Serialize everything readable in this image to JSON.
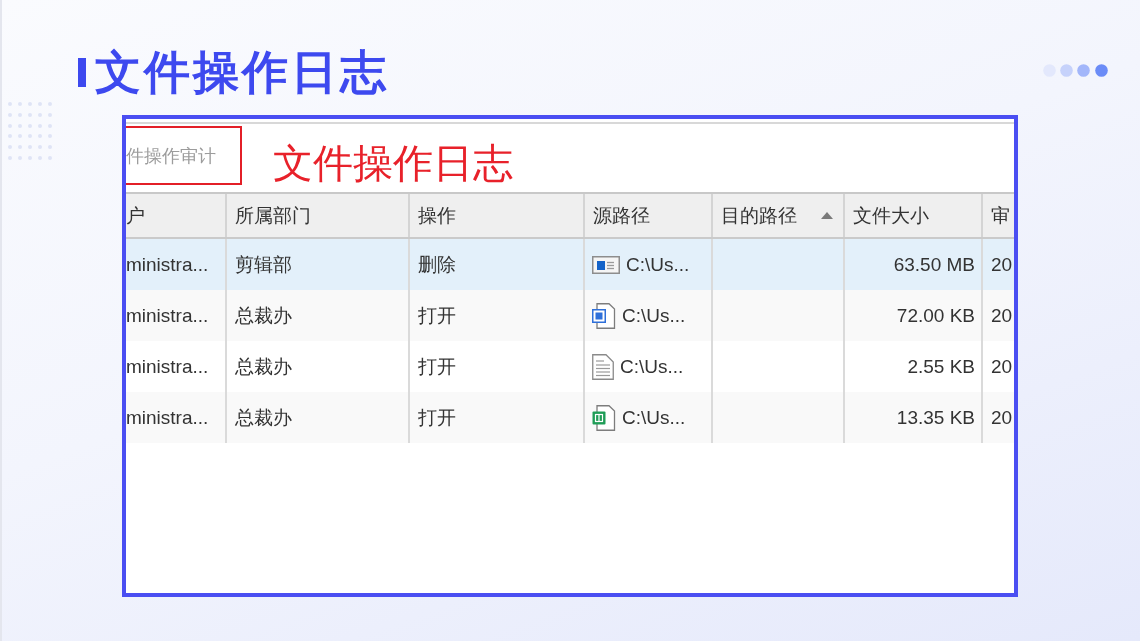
{
  "title": "文件操作日志",
  "screenshot": {
    "nav_tab": {
      "label": "件操作审计"
    },
    "annotation": "文件操作日志",
    "table": {
      "columns": [
        {
          "label": "户",
          "sorted": false
        },
        {
          "label": "所属部门",
          "sorted": false
        },
        {
          "label": "操作",
          "sorted": false
        },
        {
          "label": "源路径",
          "sorted": false
        },
        {
          "label": "目的路径",
          "sorted": true
        },
        {
          "label": "文件大小",
          "sorted": false
        },
        {
          "label": "审",
          "sorted": false
        }
      ],
      "rows": [
        {
          "selected": true,
          "kind": "media",
          "column_1": "ministra...",
          "department": "剪辑部",
          "action": "删除",
          "source_path": "C:\\Us...",
          "file_size": "63.50 MB",
          "column_7": "20"
        },
        {
          "selected": false,
          "kind": "document",
          "column_1": "ministra...",
          "department": "总裁办",
          "action": "打开",
          "source_path": "C:\\Us...",
          "file_size": "72.00 KB",
          "column_7": "20"
        },
        {
          "selected": false,
          "kind": "text",
          "column_1": "ministra...",
          "department": "总裁办",
          "action": "打开",
          "source_path": "C:\\Us...",
          "file_size": "2.55 KB",
          "column_7": "20"
        },
        {
          "selected": false,
          "kind": "spreadsheet",
          "column_1": "ministra...",
          "department": "总裁办",
          "action": "打开",
          "source_path": "C:\\Us...",
          "file_size": "13.35 KB",
          "column_7": "20"
        }
      ]
    }
  }
}
